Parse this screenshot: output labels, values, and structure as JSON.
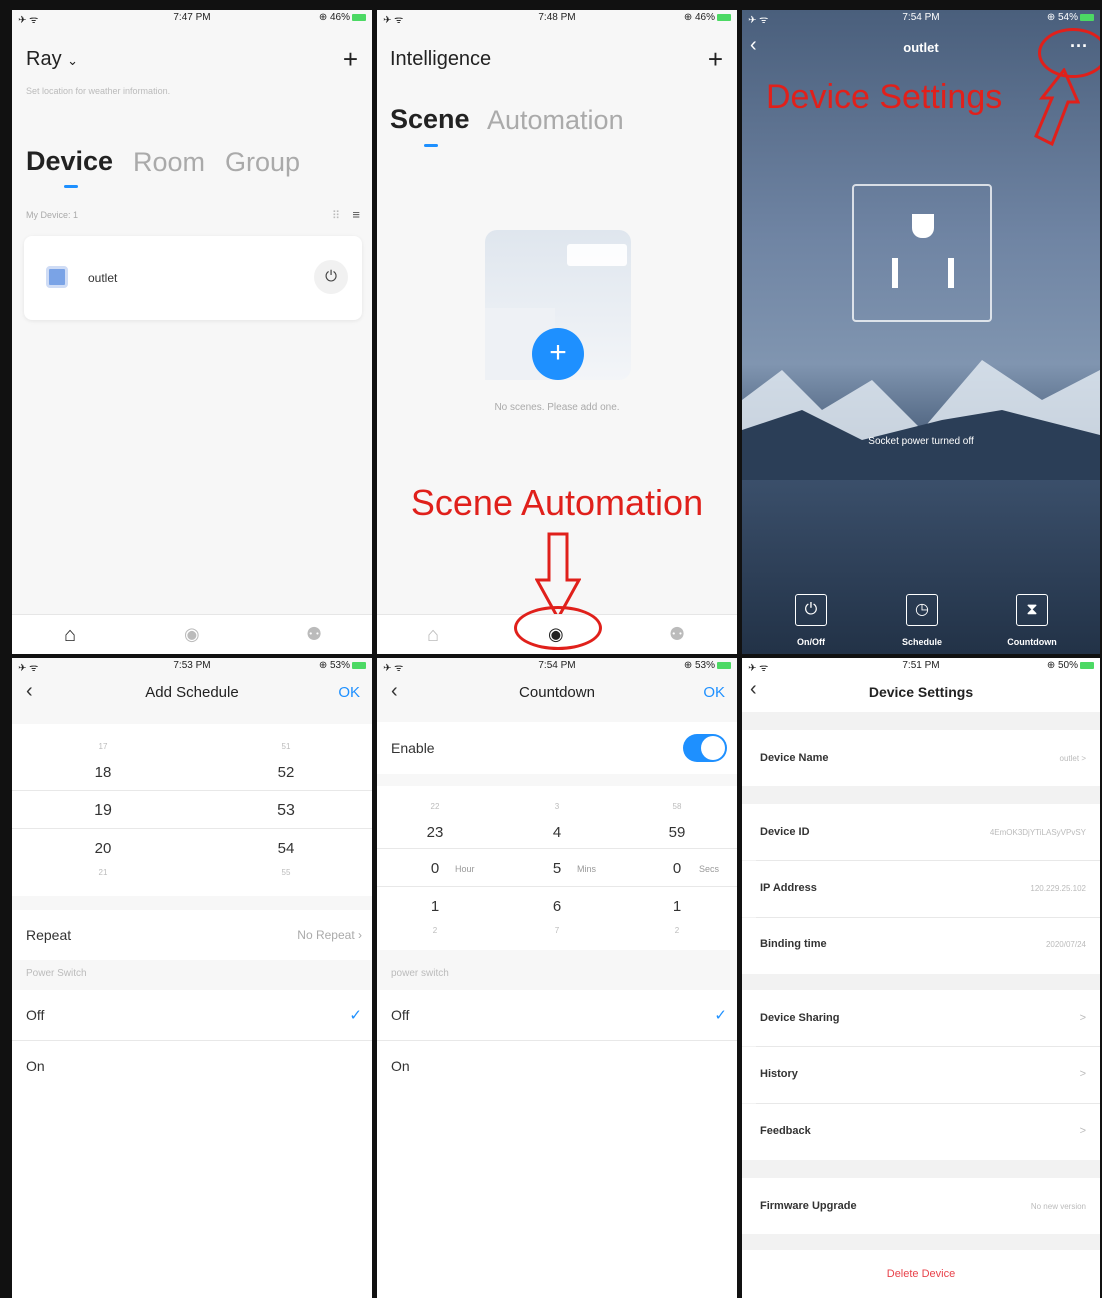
{
  "colors": {
    "accent": "#1e90ff",
    "annotation": "#e0201b",
    "delete": "#e8424a"
  },
  "p1": {
    "time": "7:47 PM",
    "battery": "46%",
    "home": "Ray",
    "home_caret": "⌄",
    "weather": "Set location for weather information.",
    "tabs": [
      "Device",
      "Room",
      "Group"
    ],
    "count_label": "My Device: 1",
    "device": "outlet"
  },
  "p2": {
    "time": "7:48 PM",
    "battery": "46%",
    "title": "Intelligence",
    "tabs": [
      "Scene",
      "Automation"
    ],
    "empty": "No scenes. Please add one.",
    "annotation": "Scene  Automation"
  },
  "p3": {
    "time": "7:54 PM",
    "battery": "54%",
    "title": "outlet",
    "annotation": "Device Settings",
    "message": "Socket power turned off",
    "controls": [
      "On/Off",
      "Schedule",
      "Countdown"
    ]
  },
  "p4": {
    "time": "7:53 PM",
    "battery": "53%",
    "title": "Add Schedule",
    "ok": "OK",
    "hours": [
      "17",
      "18",
      "19",
      "20",
      "21"
    ],
    "minutes": [
      "51",
      "52",
      "53",
      "54",
      "55"
    ],
    "repeat_label": "Repeat",
    "repeat_value": "No Repeat",
    "section": "Power Switch",
    "options": [
      "Off",
      "On"
    ]
  },
  "p5": {
    "time": "7:54 PM",
    "battery": "53%",
    "title": "Countdown",
    "ok": "OK",
    "enable": "Enable",
    "col1": [
      "22",
      "23",
      "0",
      "1",
      "2"
    ],
    "col2": [
      "3",
      "4",
      "5",
      "6",
      "7"
    ],
    "col3": [
      "58",
      "59",
      "0",
      "1",
      "2"
    ],
    "units": [
      "Hour",
      "Mins",
      "Secs"
    ],
    "section": "power switch",
    "options": [
      "Off",
      "On"
    ]
  },
  "p6": {
    "time": "7:51 PM",
    "battery": "50%",
    "title": "Device Settings",
    "rows": [
      {
        "label": "Device Name",
        "value": "outlet  >"
      },
      {
        "label": "Device ID",
        "value": "4EmOK3DjYTiLASyVPvSY"
      },
      {
        "label": "IP Address",
        "value": "120.229.25.102"
      },
      {
        "label": "Binding time",
        "value": "2020/07/24"
      },
      {
        "label": "Device Sharing",
        "value": ">"
      },
      {
        "label": "History",
        "value": ">"
      },
      {
        "label": "Feedback",
        "value": ">"
      },
      {
        "label": "Firmware Upgrade",
        "value": "No new version"
      }
    ],
    "delete": "Delete Device"
  }
}
